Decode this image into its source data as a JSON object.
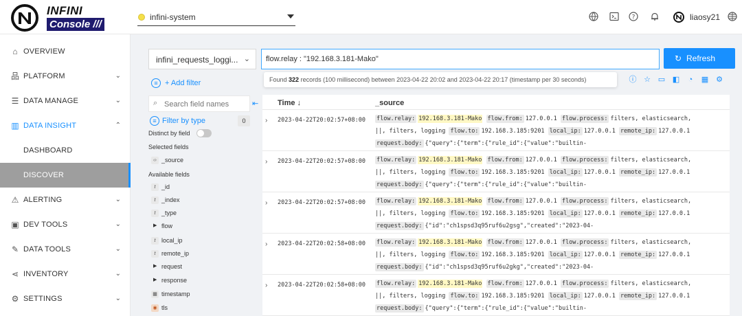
{
  "header": {
    "logo_top": "INFINI",
    "logo_bottom": "Console ///",
    "cluster": "infini-system",
    "user": "liaosy21",
    "icons": [
      "globe-icon",
      "terminal-icon",
      "help-icon",
      "bell-icon",
      "language-icon"
    ]
  },
  "sidebar": {
    "items": [
      {
        "label": "OVERVIEW",
        "icon": "home-icon"
      },
      {
        "label": "PLATFORM",
        "icon": "cluster-icon"
      },
      {
        "label": "DATA MANAGE",
        "icon": "document-icon"
      },
      {
        "label": "DATA INSIGHT",
        "icon": "chart-icon"
      },
      {
        "label": "DASHBOARD"
      },
      {
        "label": "DISCOVER"
      },
      {
        "label": "ALERTING",
        "icon": "alarm-icon"
      },
      {
        "label": "DEV TOOLS",
        "icon": "console-icon"
      },
      {
        "label": "DATA TOOLS",
        "icon": "tool-icon"
      },
      {
        "label": "INVENTORY",
        "icon": "share-icon"
      },
      {
        "label": "SETTINGS",
        "icon": "gear-icon"
      }
    ]
  },
  "query": {
    "index_pattern": "infini_requests_loggi...",
    "query_text": "flow.relay : \"192.168.3.181-Mako\"",
    "refresh_label": "Refresh",
    "found_prefix": "Found",
    "found_count": "322",
    "found_suffix": "records   (100 millisecond)  between 2023-04-22 20:02 and 2023-04-22 20:17  (timestamp per 30 seconds)"
  },
  "fields_panel": {
    "add_filter": "+ Add filter",
    "search_placeholder": "Search field names",
    "filter_by_type": "Filter by type",
    "filter_count": "0",
    "distinct_label": "Distinct by field",
    "selected_title": "Selected fields",
    "selected": [
      "_source"
    ],
    "available_title": "Available fields",
    "available": [
      {
        "name": "_id",
        "type": "t"
      },
      {
        "name": "_index",
        "type": "t"
      },
      {
        "name": "_type",
        "type": "t"
      },
      {
        "name": "flow",
        "type": "group"
      },
      {
        "name": "local_ip",
        "type": "t"
      },
      {
        "name": "remote_ip",
        "type": "t"
      },
      {
        "name": "request",
        "type": "group"
      },
      {
        "name": "response",
        "type": "group"
      },
      {
        "name": "timestamp",
        "type": "date"
      },
      {
        "name": "tls",
        "type": "geo"
      }
    ]
  },
  "table": {
    "col_time": "Time ↓",
    "col_source": "_source",
    "rows": [
      {
        "time": "2023-04-22T20:02:57+08:00",
        "relay": "192.168.3.181-Mako",
        "from": "127.0.0.1",
        "process1": "filters, elasticsearch,",
        "process2": "||, filters, logging",
        "to": "192.168.3.185:9201",
        "local_ip": "127.0.0.1",
        "remote_ip": "127.0.0.1",
        "body": "{\"query\":{\"term\":{\"rule_id\":{\"value\":\"builtin-"
      },
      {
        "time": "2023-04-22T20:02:57+08:00",
        "relay": "192.168.3.181-Mako",
        "from": "127.0.0.1",
        "process1": "filters, elasticsearch,",
        "process2": "||, filters, logging",
        "to": "192.168.3.185:9201",
        "local_ip": "127.0.0.1",
        "remote_ip": "127.0.0.1",
        "body": "{\"query\":{\"term\":{\"rule_id\":{\"value\":\"builtin-"
      },
      {
        "time": "2023-04-22T20:02:57+08:00",
        "relay": "192.168.3.181-Mako",
        "from": "127.0.0.1",
        "process1": "filters, elasticsearch,",
        "process2": "||, filters, logging",
        "to": "192.168.3.185:9201",
        "local_ip": "127.0.0.1",
        "remote_ip": "127.0.0.1",
        "body": "{\"id\":\"ch1spsd3q95ruf6u2gsg\",\"created\":\"2023-04-"
      },
      {
        "time": "2023-04-22T20:02:58+08:00",
        "relay": "192.168.3.181-Mako",
        "from": "127.0.0.1",
        "process1": "filters, elasticsearch,",
        "process2": "||, filters, logging",
        "to": "192.168.3.185:9201",
        "local_ip": "127.0.0.1",
        "remote_ip": "127.0.0.1",
        "body": "{\"id\":\"ch1spsd3q95ruf6u2gkg\",\"created\":\"2023-04-"
      },
      {
        "time": "2023-04-22T20:02:58+08:00",
        "relay": "192.168.3.181-Mako",
        "from": "127.0.0.1",
        "process1": "filters, elasticsearch,",
        "process2": "||, filters, logging",
        "to": "192.168.3.185:9201",
        "local_ip": "127.0.0.1",
        "remote_ip": "127.0.0.1",
        "body": "{\"query\":{\"term\":{\"rule_id\":{\"value\":\"builtin-"
      }
    ],
    "keys": {
      "relay": "flow.relay:",
      "from": "flow.from:",
      "process": "flow.process:",
      "to": "flow.to:",
      "local_ip": "local_ip:",
      "remote_ip": "remote_ip:",
      "body": "request.body:"
    }
  }
}
